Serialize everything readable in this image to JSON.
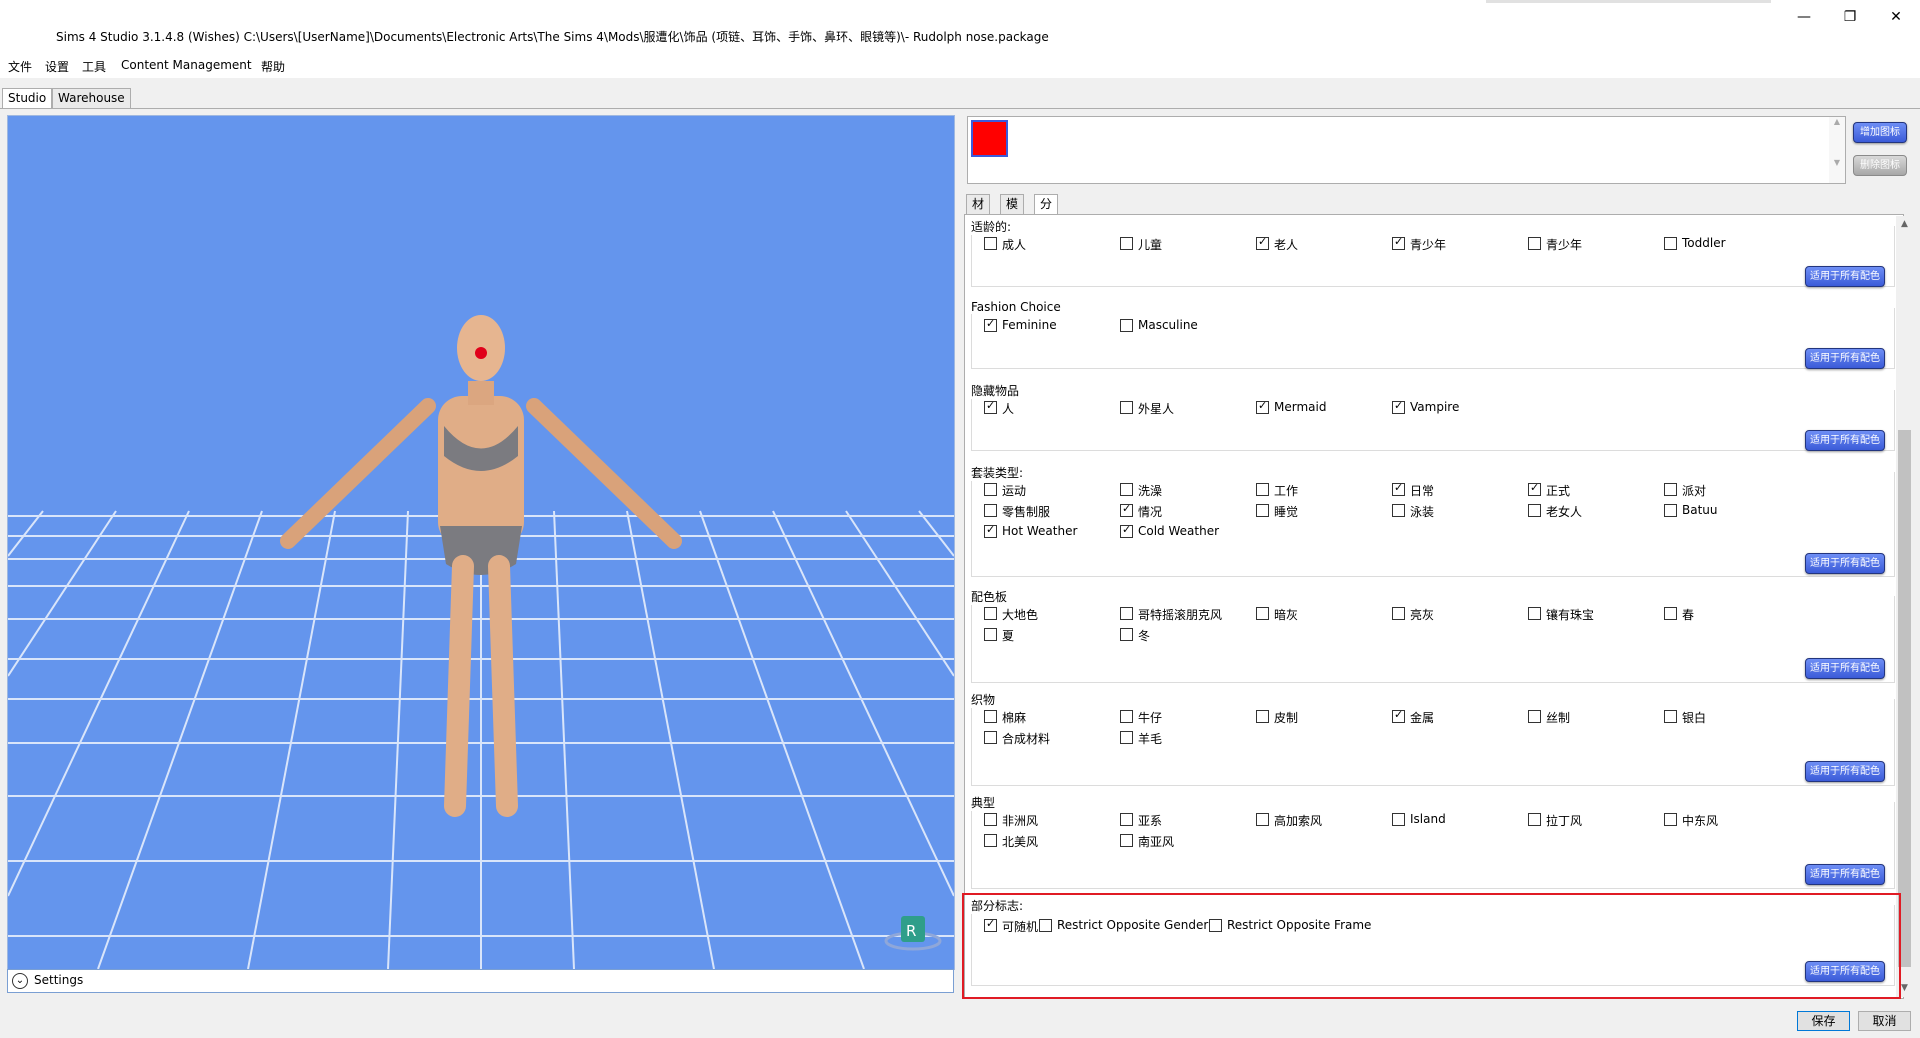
{
  "window": {
    "title": "Sims 4 Studio 3.1.4.8 (Wishes)  C:\\Users\\[UserName]\\Documents\\Electronic Arts\\The Sims 4\\Mods\\服遭化\\饰品 (项链、耳饰、手饰、鼻环、眼镜等)\\- Rudolph nose.package",
    "minimize": "—",
    "restore": "❐",
    "close": "✕"
  },
  "menu": [
    "文件",
    "设置",
    "工具",
    "Content Management",
    "帮助"
  ],
  "main_tabs": [
    "Studio",
    "Warehouse"
  ],
  "viewport": {
    "settings_label": "Settings",
    "settings_icon": "chevron-down-icon",
    "badge_letter": "R"
  },
  "swatch": {
    "color": "#ff0000"
  },
  "swatch_buttons": {
    "add": "增加图标",
    "remove": "删除图标"
  },
  "sub_tabs": [
    "材质",
    "模型",
    "分类"
  ],
  "apply_label": "适用于所有配色",
  "sections": [
    {
      "title": "适龄的:",
      "rows": [
        [
          {
            "label": "成人",
            "checked": false
          },
          {
            "label": "儿童",
            "checked": false
          },
          {
            "label": "老人",
            "checked": true
          },
          {
            "label": "青少年",
            "checked": true
          },
          {
            "label": "青少年",
            "checked": false
          },
          {
            "label": "Toddler",
            "checked": false
          }
        ]
      ]
    },
    {
      "title": "Fashion Choice",
      "rows": [
        [
          {
            "label": "Feminine",
            "checked": true
          },
          {
            "label": "Masculine",
            "checked": false
          }
        ]
      ]
    },
    {
      "title": "隐藏物品",
      "rows": [
        [
          {
            "label": "人",
            "checked": true
          },
          {
            "label": "外星人",
            "checked": false
          },
          {
            "label": "Mermaid",
            "checked": true
          },
          {
            "label": "Vampire",
            "checked": true
          }
        ]
      ]
    },
    {
      "title": "套装类型:",
      "rows": [
        [
          {
            "label": "运动",
            "checked": false
          },
          {
            "label": "洗澡",
            "checked": false
          },
          {
            "label": "工作",
            "checked": false
          },
          {
            "label": "日常",
            "checked": true
          },
          {
            "label": "正式",
            "checked": true
          },
          {
            "label": "派对",
            "checked": false
          }
        ],
        [
          {
            "label": "零售制服",
            "checked": false
          },
          {
            "label": "情况",
            "checked": true
          },
          {
            "label": "睡觉",
            "checked": false
          },
          {
            "label": "泳装",
            "checked": false
          },
          {
            "label": "老女人",
            "checked": false
          },
          {
            "label": "Batuu",
            "checked": false
          }
        ],
        [
          {
            "label": "Hot Weather",
            "checked": true
          },
          {
            "label": "Cold Weather",
            "checked": true
          }
        ]
      ]
    },
    {
      "title": "配色板",
      "rows": [
        [
          {
            "label": "大地色",
            "checked": false
          },
          {
            "label": "哥特摇滚朋克风",
            "checked": false
          },
          {
            "label": "暗灰",
            "checked": false
          },
          {
            "label": "亮灰",
            "checked": false
          },
          {
            "label": "镶有珠宝",
            "checked": false
          },
          {
            "label": "春",
            "checked": false
          }
        ],
        [
          {
            "label": "夏",
            "checked": false
          },
          {
            "label": "冬",
            "checked": false
          }
        ]
      ]
    },
    {
      "title": "织物",
      "rows": [
        [
          {
            "label": "棉麻",
            "checked": false
          },
          {
            "label": "牛仔",
            "checked": false
          },
          {
            "label": "皮制",
            "checked": false
          },
          {
            "label": "金属",
            "checked": true
          },
          {
            "label": "丝制",
            "checked": false
          },
          {
            "label": "银白",
            "checked": false
          }
        ],
        [
          {
            "label": "合成材料",
            "checked": false
          },
          {
            "label": "羊毛",
            "checked": false
          }
        ]
      ]
    },
    {
      "title": "典型",
      "rows": [
        [
          {
            "label": "非洲风",
            "checked": false
          },
          {
            "label": "亚系",
            "checked": false
          },
          {
            "label": "高加索风",
            "checked": false
          },
          {
            "label": "Island",
            "checked": false
          },
          {
            "label": "拉丁风",
            "checked": false
          },
          {
            "label": "中东风",
            "checked": false
          }
        ],
        [
          {
            "label": "北美风",
            "checked": false
          },
          {
            "label": "南亚风",
            "checked": false
          }
        ]
      ]
    }
  ],
  "flags_section": {
    "title": "部分标志:",
    "items": [
      {
        "label": "可随机",
        "checked": true
      },
      {
        "label": "Restrict Opposite Gender",
        "checked": false
      },
      {
        "label": "Restrict Opposite Frame",
        "checked": false
      }
    ]
  },
  "footer": {
    "save": "保存",
    "cancel": "取消"
  }
}
